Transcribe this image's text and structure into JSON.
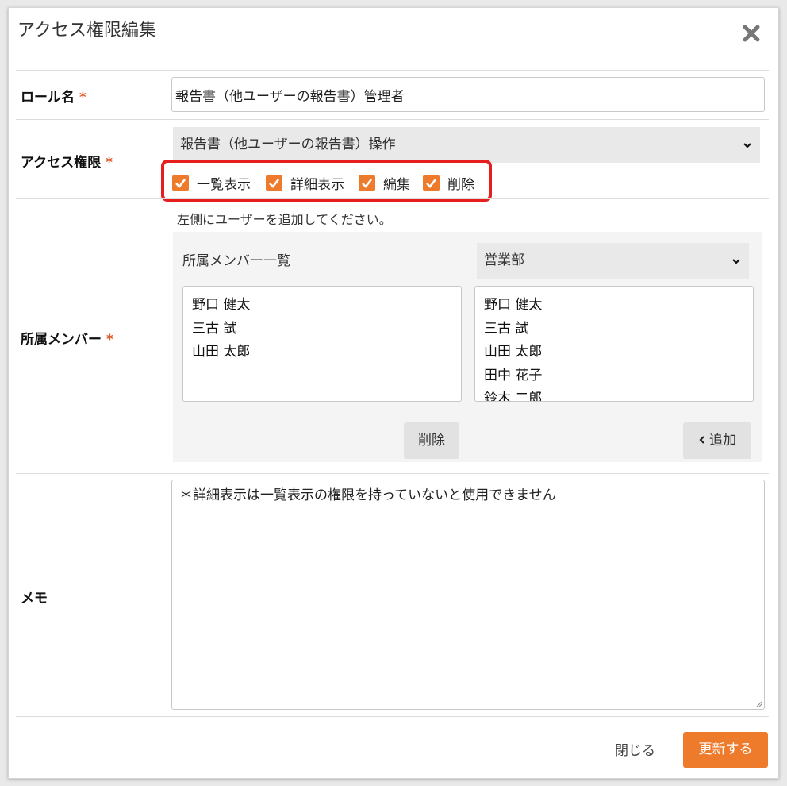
{
  "dialog": {
    "title": "アクセス権限編集"
  },
  "role": {
    "label": "ロール名",
    "required_mark": "*",
    "value": "報告書（他ユーザーの報告書）管理者"
  },
  "access": {
    "label": "アクセス権限",
    "required_mark": "*",
    "selected": "報告書（他ユーザーの報告書）操作",
    "options": [
      {
        "label": "一覧表示",
        "checked": true
      },
      {
        "label": "詳細表示",
        "checked": true
      },
      {
        "label": "編集",
        "checked": true
      },
      {
        "label": "削除",
        "checked": true
      }
    ]
  },
  "members": {
    "label": "所属メンバー",
    "required_mark": "*",
    "hint": "左側にユーザーを追加してください。",
    "list_label": "所属メンバー一覧",
    "department": "営業部",
    "current": [
      "野口 健太",
      "三古 試",
      "山田 太郎"
    ],
    "available": [
      "野口 健太",
      "三古 試",
      "山田 太郎",
      "田中 花子",
      "鈴木 二郎"
    ],
    "remove_label": "削除",
    "add_label": "追加"
  },
  "memo": {
    "label": "メモ",
    "value": "＊詳細表示は一覧表示の権限を持っていないと使用できません"
  },
  "footer": {
    "close_label": "閉じる",
    "update_label": "更新する"
  },
  "colors": {
    "accent": "#ee7a2b",
    "highlight_border": "#e61e1e",
    "required": "#e05a2a"
  }
}
